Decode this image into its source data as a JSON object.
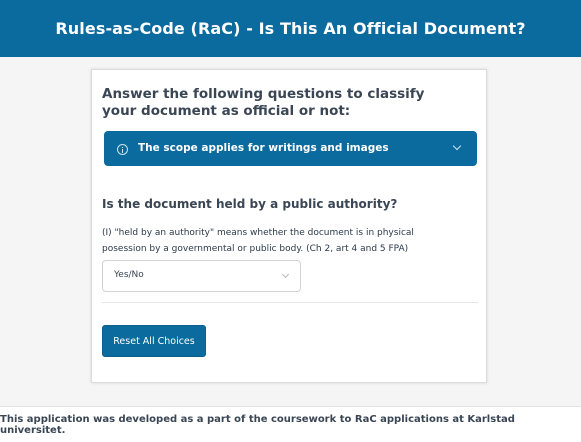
{
  "header": {
    "title": "Rules-as-Code (RaC) - Is This An Official Document?"
  },
  "card": {
    "title": "Answer the following questions to classify your document as official or not:",
    "info_bar": {
      "text": "The scope applies for writings and images",
      "icon": "info-icon"
    },
    "question": {
      "title": "Is the document held by a public authority?",
      "hint": "(I) \"held by an authority\" means whether the document is in physical posession by a governmental or public body. (Ch 2, art 4 and 5 FPA)",
      "select_value": "Yes/No"
    },
    "reset_label": "Reset All Choices"
  },
  "footer": {
    "text": "This application was developed as a part of the coursework to RaC applications at Karlstad universitet."
  },
  "colors": {
    "accent": "#0b6a9e",
    "background": "#f5f5f5"
  }
}
